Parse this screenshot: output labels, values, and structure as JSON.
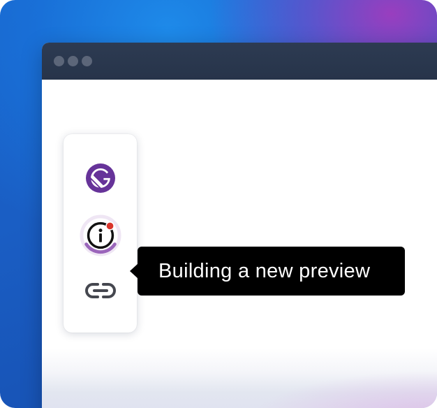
{
  "toolbar": {
    "buttons": [
      {
        "icon": "gatsby-logo-icon",
        "color": "#663399"
      },
      {
        "icon": "info-icon",
        "status_dot_color": "#d9342b",
        "ring_color": "#8a4baf"
      },
      {
        "icon": "link-icon",
        "color": "#45474f"
      }
    ]
  },
  "tooltip": {
    "text": "Building a new preview"
  },
  "colors": {
    "titlebar": "#2d3b52",
    "window_dots": "#5c6679",
    "tooltip_bg": "#000000",
    "accent_purple": "#663399"
  }
}
